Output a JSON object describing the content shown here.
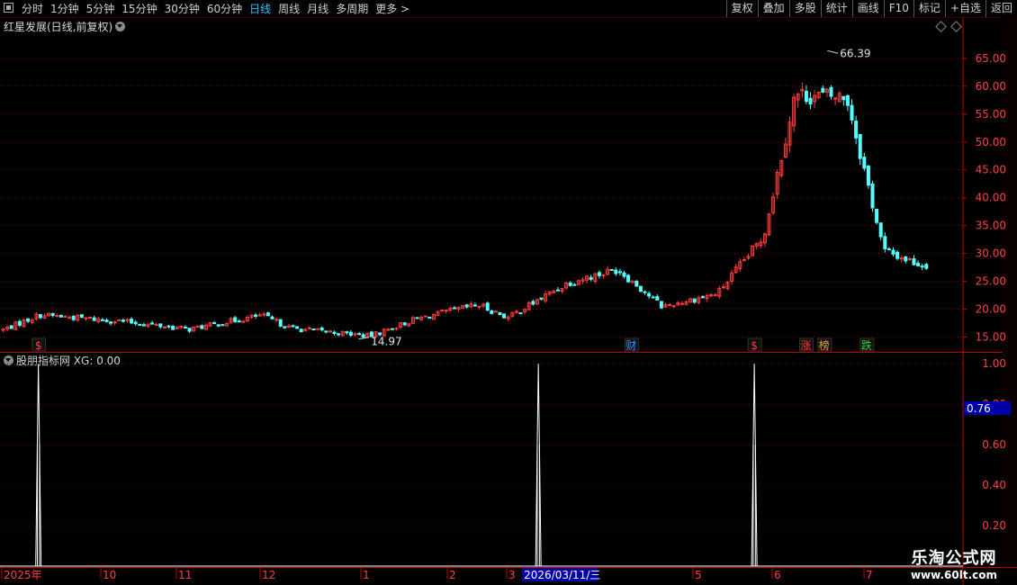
{
  "toolbar": {
    "tabs": [
      "分时",
      "1分钟",
      "5分钟",
      "15分钟",
      "30分钟",
      "60分钟",
      "日线",
      "周线",
      "月线",
      "多周期",
      "更多 >"
    ],
    "active_tab": "日线",
    "right_buttons": [
      "复权",
      "叠加",
      "多股",
      "统计",
      "画线",
      "F10",
      "标记",
      "+自选",
      "返回"
    ]
  },
  "main_title": "红星发展(日线,前复权)",
  "indicator_title": "股朋指标网 XG: 0.00",
  "current_value_badge": "0.76",
  "price_high_label": "66.39",
  "price_low_label": "14.97",
  "markers": [
    {
      "text": "$",
      "color": "#ff3b3b",
      "date": "2025-09-05"
    },
    {
      "text": "财",
      "color": "#3f8bff",
      "date": "2026-04-10"
    },
    {
      "text": "$",
      "color": "#ff3b3b",
      "date": "2026-05-25"
    },
    {
      "text": "涨",
      "color": "#ff3b3b",
      "date": "2026-06-12"
    },
    {
      "text": "榜",
      "color": "#e8a040",
      "date": "2026-06-18"
    },
    {
      "text": "跌",
      "color": "#3ccf3c",
      "date": "2026-07-02"
    }
  ],
  "date_axis": {
    "labels": [
      "2025年",
      "10",
      "11",
      "12",
      "1",
      "2",
      "3",
      "5",
      "6",
      "7"
    ],
    "cursor_date": "2026/03/11/三"
  },
  "price_axis": [
    "65.00",
    "60.00",
    "55.00",
    "50.00",
    "45.00",
    "40.00",
    "35.00",
    "30.00",
    "25.00",
    "20.00",
    "15.00"
  ],
  "indicator_axis": [
    "1.00",
    "0.80",
    "0.60",
    "0.40",
    "0.20"
  ],
  "watermark": {
    "line1": "乐淘公式网",
    "line2": "www.60lt.com"
  },
  "colors": {
    "up": "#ff3b3b",
    "down": "#54ffff",
    "grid": "#7a0000",
    "axis": "#c00000",
    "active_tab": "#3fc4ff",
    "signal": "#ffffff"
  },
  "chart_data": [
    {
      "type": "candlestick",
      "title": "红星发展(日线,前复权)",
      "y_ticks": [
        65,
        60,
        55,
        50,
        45,
        40,
        35,
        30,
        25,
        20,
        15
      ],
      "ylim": [
        12.5,
        69.5
      ],
      "x_labels": [
        "2025年",
        "10",
        "11",
        "12",
        "1",
        "2",
        "3",
        "5",
        "6",
        "7"
      ],
      "close_path": [
        {
          "date": "2025-08-20",
          "close": 16.2
        },
        {
          "date": "2025-09-05",
          "close": 19.0
        },
        {
          "date": "2025-10-10",
          "close": 17.8
        },
        {
          "date": "2025-11-05",
          "close": 16.4
        },
        {
          "date": "2025-12-01",
          "close": 18.9
        },
        {
          "date": "2025-12-10",
          "close": 16.6
        },
        {
          "date": "2026-01-04",
          "close": 15.2
        },
        {
          "date": "2026-01-20",
          "close": 18.2
        },
        {
          "date": "2026-02-15",
          "close": 20.8
        },
        {
          "date": "2026-03-01",
          "close": 18.5
        },
        {
          "date": "2026-03-20",
          "close": 24.8
        },
        {
          "date": "2026-04-05",
          "close": 27.2
        },
        {
          "date": "2026-04-20",
          "close": 20.5
        },
        {
          "date": "2026-05-10",
          "close": 22.8
        },
        {
          "date": "2026-05-28",
          "close": 33.0
        },
        {
          "date": "2026-06-08",
          "close": 58.5
        },
        {
          "date": "2026-06-25",
          "close": 58.0
        },
        {
          "date": "2026-07-08",
          "close": 30.5
        },
        {
          "date": "2026-07-22",
          "close": 28.0
        }
      ],
      "high_point": {
        "value": 66.39
      },
      "low_point": {
        "value": 14.97
      }
    },
    {
      "type": "line",
      "title": "股朋指标网 XG: 0.00",
      "series": [
        {
          "name": "XG",
          "values": [
            0,
            1,
            0,
            1,
            0,
            1,
            0
          ]
        }
      ],
      "y_ticks": [
        1.0,
        0.8,
        0.6,
        0.4,
        0.2
      ],
      "ylim": [
        0,
        1.05
      ],
      "signal_dates": [
        "2025-09-05",
        "2026-03-11",
        "2026-05-25"
      ]
    }
  ]
}
